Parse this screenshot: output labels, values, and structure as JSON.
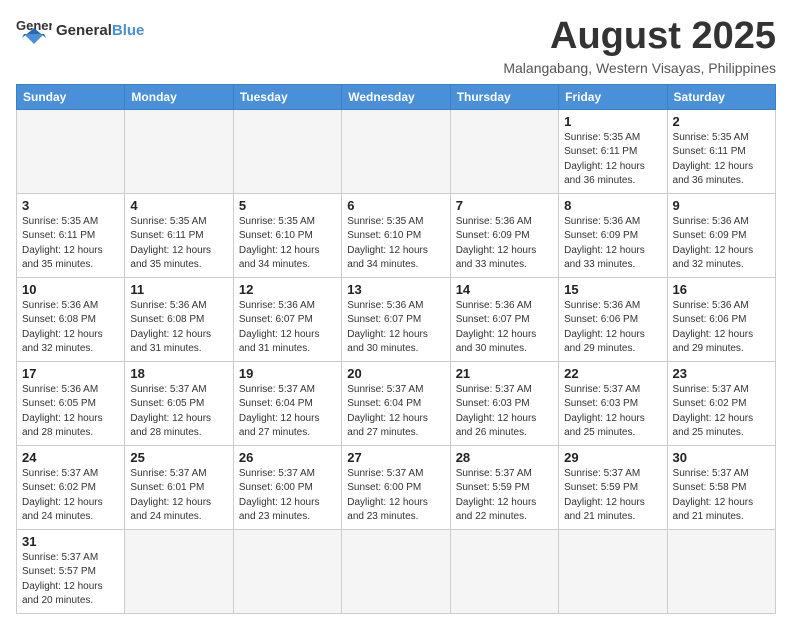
{
  "logo": {
    "general": "General",
    "blue": "Blue"
  },
  "title": "August 2025",
  "location": "Malangabang, Western Visayas, Philippines",
  "weekdays": [
    "Sunday",
    "Monday",
    "Tuesday",
    "Wednesday",
    "Thursday",
    "Friday",
    "Saturday"
  ],
  "days": {
    "1": "Sunrise: 5:35 AM\nSunset: 6:11 PM\nDaylight: 12 hours and 36 minutes.",
    "2": "Sunrise: 5:35 AM\nSunset: 6:11 PM\nDaylight: 12 hours and 36 minutes.",
    "3": "Sunrise: 5:35 AM\nSunset: 6:11 PM\nDaylight: 12 hours and 35 minutes.",
    "4": "Sunrise: 5:35 AM\nSunset: 6:11 PM\nDaylight: 12 hours and 35 minutes.",
    "5": "Sunrise: 5:35 AM\nSunset: 6:10 PM\nDaylight: 12 hours and 34 minutes.",
    "6": "Sunrise: 5:35 AM\nSunset: 6:10 PM\nDaylight: 12 hours and 34 minutes.",
    "7": "Sunrise: 5:36 AM\nSunset: 6:09 PM\nDaylight: 12 hours and 33 minutes.",
    "8": "Sunrise: 5:36 AM\nSunset: 6:09 PM\nDaylight: 12 hours and 33 minutes.",
    "9": "Sunrise: 5:36 AM\nSunset: 6:09 PM\nDaylight: 12 hours and 32 minutes.",
    "10": "Sunrise: 5:36 AM\nSunset: 6:08 PM\nDaylight: 12 hours and 32 minutes.",
    "11": "Sunrise: 5:36 AM\nSunset: 6:08 PM\nDaylight: 12 hours and 31 minutes.",
    "12": "Sunrise: 5:36 AM\nSunset: 6:07 PM\nDaylight: 12 hours and 31 minutes.",
    "13": "Sunrise: 5:36 AM\nSunset: 6:07 PM\nDaylight: 12 hours and 30 minutes.",
    "14": "Sunrise: 5:36 AM\nSunset: 6:07 PM\nDaylight: 12 hours and 30 minutes.",
    "15": "Sunrise: 5:36 AM\nSunset: 6:06 PM\nDaylight: 12 hours and 29 minutes.",
    "16": "Sunrise: 5:36 AM\nSunset: 6:06 PM\nDaylight: 12 hours and 29 minutes.",
    "17": "Sunrise: 5:36 AM\nSunset: 6:05 PM\nDaylight: 12 hours and 28 minutes.",
    "18": "Sunrise: 5:37 AM\nSunset: 6:05 PM\nDaylight: 12 hours and 28 minutes.",
    "19": "Sunrise: 5:37 AM\nSunset: 6:04 PM\nDaylight: 12 hours and 27 minutes.",
    "20": "Sunrise: 5:37 AM\nSunset: 6:04 PM\nDaylight: 12 hours and 27 minutes.",
    "21": "Sunrise: 5:37 AM\nSunset: 6:03 PM\nDaylight: 12 hours and 26 minutes.",
    "22": "Sunrise: 5:37 AM\nSunset: 6:03 PM\nDaylight: 12 hours and 25 minutes.",
    "23": "Sunrise: 5:37 AM\nSunset: 6:02 PM\nDaylight: 12 hours and 25 minutes.",
    "24": "Sunrise: 5:37 AM\nSunset: 6:02 PM\nDaylight: 12 hours and 24 minutes.",
    "25": "Sunrise: 5:37 AM\nSunset: 6:01 PM\nDaylight: 12 hours and 24 minutes.",
    "26": "Sunrise: 5:37 AM\nSunset: 6:00 PM\nDaylight: 12 hours and 23 minutes.",
    "27": "Sunrise: 5:37 AM\nSunset: 6:00 PM\nDaylight: 12 hours and 23 minutes.",
    "28": "Sunrise: 5:37 AM\nSunset: 5:59 PM\nDaylight: 12 hours and 22 minutes.",
    "29": "Sunrise: 5:37 AM\nSunset: 5:59 PM\nDaylight: 12 hours and 21 minutes.",
    "30": "Sunrise: 5:37 AM\nSunset: 5:58 PM\nDaylight: 12 hours and 21 minutes.",
    "31": "Sunrise: 5:37 AM\nSunset: 5:57 PM\nDaylight: 12 hours and 20 minutes."
  }
}
